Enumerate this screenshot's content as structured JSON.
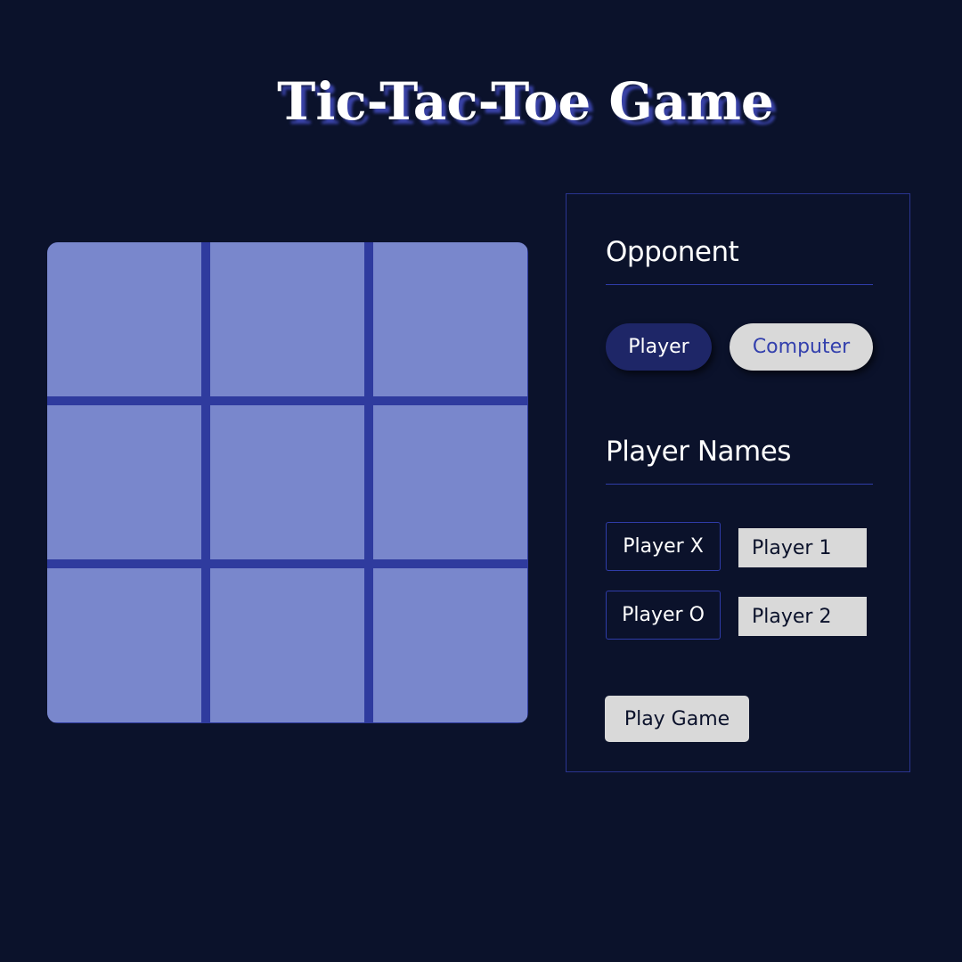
{
  "header": {
    "title": "Tic-Tac-Toe Game"
  },
  "board": {
    "rows": 3,
    "columns": 3,
    "cells": [
      "",
      "",
      "",
      "",
      "",
      "",
      "",
      "",
      ""
    ]
  },
  "settings": {
    "opponent": {
      "heading": "Opponent",
      "options": [
        {
          "label": "Player",
          "selected": true
        },
        {
          "label": "Computer",
          "selected": false
        }
      ]
    },
    "player_names": {
      "heading": "Player Names",
      "fields": [
        {
          "label": "Player X",
          "value": "Player 1"
        },
        {
          "label": "Player O",
          "value": "Player 2"
        }
      ]
    },
    "play_button_label": "Play Game"
  },
  "colors": {
    "background": "#0b122b",
    "board_cell": "#7987cc",
    "board_grid": "#2f3b9e",
    "accent": "#3340ad",
    "selected_option": "#1e2667",
    "unselected_option": "#d9d9d9"
  }
}
